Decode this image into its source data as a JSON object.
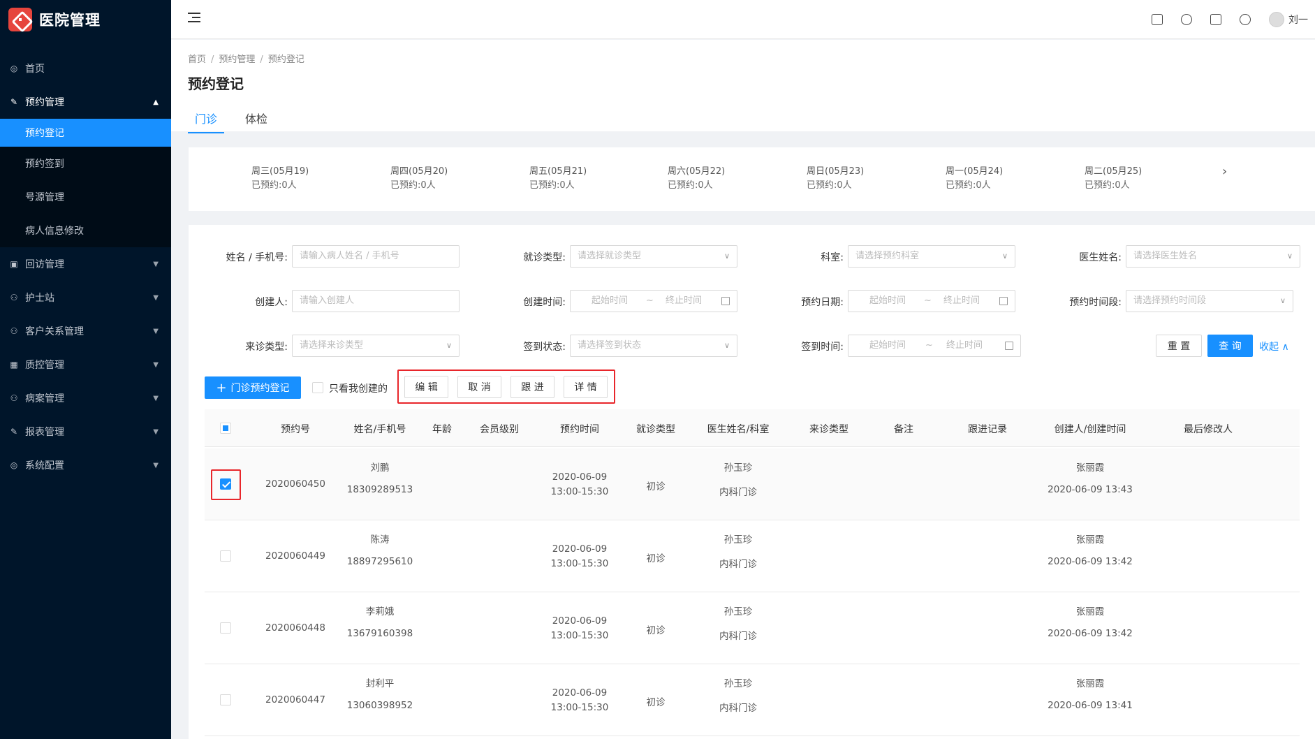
{
  "app": {
    "title": "医院管理",
    "user_name": "刘一"
  },
  "sidebar": {
    "items": [
      {
        "label": "首页",
        "icon": "dashboard-icon"
      },
      {
        "label": "预约管理",
        "icon": "edit-icon",
        "open": true,
        "children": [
          {
            "label": "预约登记",
            "active": true
          },
          {
            "label": "预约签到"
          },
          {
            "label": "号源管理"
          },
          {
            "label": "病人信息修改"
          }
        ]
      },
      {
        "label": "回访管理",
        "icon": "lock-icon"
      },
      {
        "label": "护士站",
        "icon": "user-icon"
      },
      {
        "label": "客户关系管理",
        "icon": "user-icon"
      },
      {
        "label": "质控管理",
        "icon": "table-icon"
      },
      {
        "label": "病案管理",
        "icon": "user-icon"
      },
      {
        "label": "报表管理",
        "icon": "edit-icon"
      },
      {
        "label": "系统配置",
        "icon": "dashboard-icon"
      }
    ]
  },
  "breadcrumb": [
    "首页",
    "预约管理",
    "预约登记"
  ],
  "page_title": "预约登记",
  "tabs": [
    {
      "label": "门诊",
      "active": true
    },
    {
      "label": "体检"
    }
  ],
  "days": [
    {
      "label": "周三(05月19)",
      "count": "已预约:0人"
    },
    {
      "label": "周四(05月20)",
      "count": "已预约:0人"
    },
    {
      "label": "周五(05月21)",
      "count": "已预约:0人"
    },
    {
      "label": "周六(05月22)",
      "count": "已预约:0人"
    },
    {
      "label": "周日(05月23)",
      "count": "已预约:0人"
    },
    {
      "label": "周一(05月24)",
      "count": "已预约:0人"
    },
    {
      "label": "周二(05月25)",
      "count": "已预约:0人"
    }
  ],
  "filters": {
    "name_label": "姓名 / 手机号:",
    "name_ph": "请输入病人姓名 / 手机号",
    "visit_type_label": "就诊类型:",
    "visit_type_ph": "请选择就诊类型",
    "dept_label": "科室:",
    "dept_ph": "请选择预约科室",
    "doctor_label": "医生姓名:",
    "doctor_ph": "请选择医生姓名",
    "creator_label": "创建人:",
    "creator_ph": "请输入创建人",
    "create_time_label": "创建时间:",
    "appt_date_label": "预约日期:",
    "appt_slot_label": "预约时间段:",
    "appt_slot_ph": "请选择预约时间段",
    "source_label": "来诊类型:",
    "source_ph": "请选择来诊类型",
    "checkin_label": "签到状态:",
    "checkin_ph": "请选择签到状态",
    "checkin_time_label": "签到时间:",
    "start_ph": "起始时间",
    "end_ph": "终止时间",
    "range_sep": "~",
    "reset": "重 置",
    "query": "查 询",
    "collapse": "收起"
  },
  "toolbar": {
    "add": "门诊预约登记",
    "only_mine": "只看我创建的",
    "edit": "编 辑",
    "cancel": "取 消",
    "follow": "跟 进",
    "detail": "详 情"
  },
  "table": {
    "columns": [
      "预约号",
      "姓名/手机号",
      "年龄",
      "会员级别",
      "预约时间",
      "就诊类型",
      "医生姓名/科室",
      "来诊类型",
      "备注",
      "跟进记录",
      "创建人/创建时间",
      "最后修改人"
    ],
    "rows": [
      {
        "no": "2020060450",
        "name": "刘鹏",
        "phone": "18309289513",
        "date": "2020-06-09",
        "slot": "13:00-15:30",
        "type": "初诊",
        "doctor": "孙玉珍",
        "dept": "内科门诊",
        "creator": "张丽霞",
        "created": "2020-06-09 13:43",
        "checked": true
      },
      {
        "no": "2020060449",
        "name": "陈涛",
        "phone": "18897295610",
        "date": "2020-06-09",
        "slot": "13:00-15:30",
        "type": "初诊",
        "doctor": "孙玉珍",
        "dept": "内科门诊",
        "creator": "张丽霞",
        "created": "2020-06-09 13:42",
        "checked": false
      },
      {
        "no": "2020060448",
        "name": "李莉娥",
        "phone": "13679160398",
        "date": "2020-06-09",
        "slot": "13:00-15:30",
        "type": "初诊",
        "doctor": "孙玉珍",
        "dept": "内科门诊",
        "creator": "张丽霞",
        "created": "2020-06-09 13:42",
        "checked": false
      },
      {
        "no": "2020060447",
        "name": "封利平",
        "phone": "13060398952",
        "date": "2020-06-09",
        "slot": "13:00-15:30",
        "type": "初诊",
        "doctor": "孙玉珍",
        "dept": "内科门诊",
        "creator": "张丽霞",
        "created": "2020-06-09 13:41",
        "checked": false
      }
    ]
  },
  "colors": {
    "primary": "#1890ff",
    "sidebar_bg": "#00152a",
    "highlight_red": "#e8262b"
  }
}
